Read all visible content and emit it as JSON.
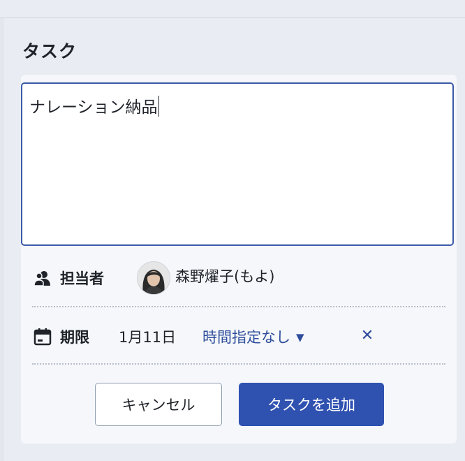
{
  "section": {
    "title": "タスク"
  },
  "task_input": {
    "value": "ナレーション納品"
  },
  "assignee": {
    "label": "担当者",
    "name": "森野燿子(もよ)"
  },
  "due": {
    "label": "期限",
    "date": "1月11日",
    "time_option": "時間指定なし",
    "clear_symbol": "✕"
  },
  "buttons": {
    "cancel": "キャンセル",
    "add": "タスクを追加"
  },
  "colors": {
    "accent": "#2f51b0",
    "link": "#2f4d9c",
    "input_border": "#3b5aa6",
    "background": "#e9edf3"
  },
  "icons": {
    "assignee": "people-icon",
    "due": "calendar-icon",
    "dropdown": "caret-down-icon",
    "clear": "close-icon"
  }
}
